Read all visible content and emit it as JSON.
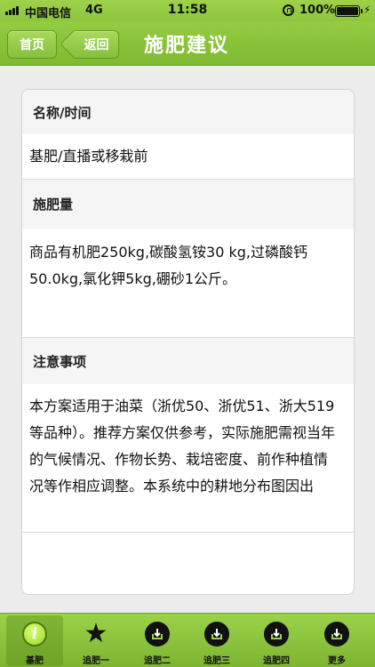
{
  "status_bar": {
    "carrier": "中国电信",
    "network": "4G",
    "time": "11:58",
    "battery": "100%",
    "battery_level": 1.0
  },
  "nav": {
    "home_label": "首页",
    "back_label": "返回",
    "title": "施肥建议"
  },
  "sections": {
    "name_time": {
      "header": "名称/时间",
      "value": "基肥/直播或移栽前"
    },
    "amount": {
      "header": "施肥量",
      "value": "商品有机肥250kg,碳酸氢铵30 kg,过磷酸钙50.0kg,氯化钾5kg,硼砂1公斤。"
    },
    "notes": {
      "header": "注意事项",
      "value": "本方案适用于油菜（浙优50、浙优51、浙大519等品种）。推荐方案仅供参考，实际施肥需视当年的气候情况、作物长势、栽培密度、前作种植情况等作相应调整。本系统中的耕地分布图因出"
    }
  },
  "tabs": [
    {
      "label": "基肥",
      "icon": "info-icon",
      "active": true
    },
    {
      "label": "追肥一",
      "icon": "star-icon",
      "active": false
    },
    {
      "label": "追肥二",
      "icon": "download-box-icon",
      "active": false
    },
    {
      "label": "追肥三",
      "icon": "download-box-icon",
      "active": false
    },
    {
      "label": "追肥四",
      "icon": "download-box-icon",
      "active": false
    },
    {
      "label": "更多",
      "icon": "download-box-icon",
      "active": false
    }
  ],
  "colors": {
    "accent": "#8dc63f",
    "accent_dark": "#5d9a1f"
  }
}
